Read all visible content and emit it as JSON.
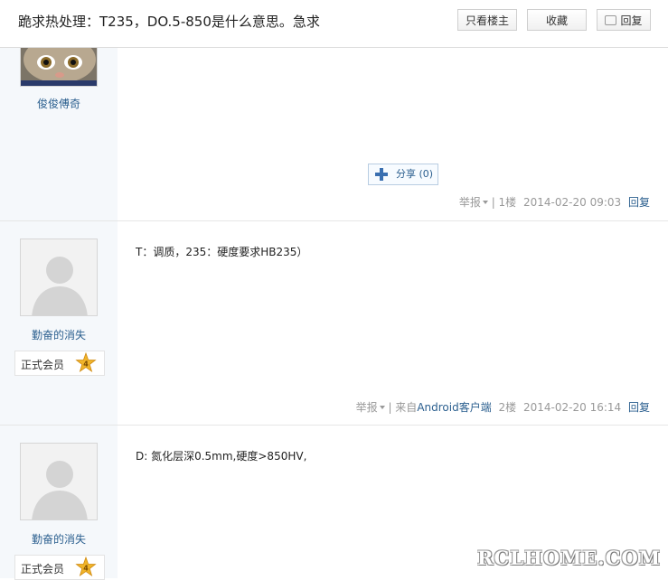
{
  "header": {
    "title": "跪求热处理：T235，DO.5-850是什么意思。急求",
    "btn_author_only": "只看楼主",
    "btn_favorite": "收藏",
    "btn_reply": "回复"
  },
  "posts": [
    {
      "username": "俊俊傅奇",
      "share_label": "分享 (0)",
      "report": "举报",
      "source": "",
      "floor": "1楼",
      "time": "2014-02-20 09:03",
      "reply": "回复"
    },
    {
      "username": "勤奋的消失",
      "rank_label": "正式会员",
      "rank_level": "4",
      "content": "T：调质，235：硬度要求HB235）",
      "report": "举报",
      "source_prefix": "来自",
      "source_link": "Android客户端",
      "floor": "2楼",
      "time": "2014-02-20 16:14",
      "reply": "回复"
    },
    {
      "username": "勤奋的消失",
      "rank_label": "正式会员",
      "rank_level": "4",
      "content": "D: 氮化层深0.5mm,硬度>850HV,"
    }
  ],
  "watermark": "RCLHOME.COM",
  "colors": {
    "link": "#2b5f8f",
    "sidebar_bg": "#f5f8fb",
    "meta": "#999999"
  }
}
